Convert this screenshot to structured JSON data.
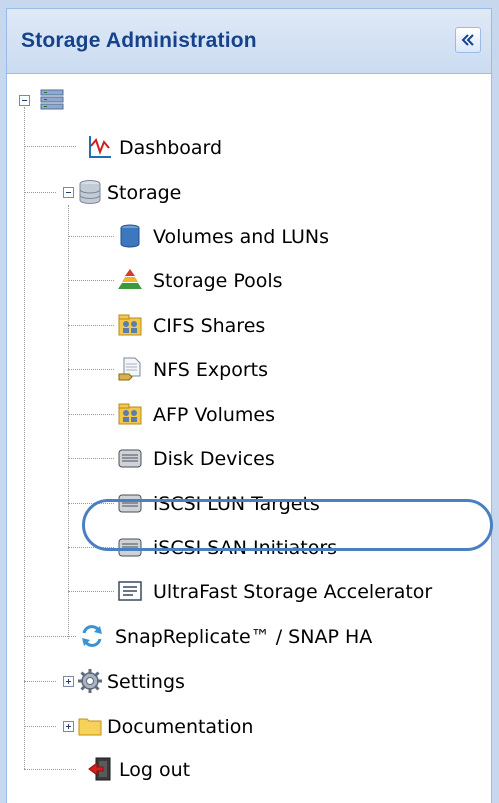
{
  "panel": {
    "title": "Storage Administration",
    "collapse_icon": "double-chevron-left-icon"
  },
  "tree": {
    "root_icon": "server-icon",
    "dashboard": {
      "label": "Dashboard",
      "icon": "line-chart-icon"
    },
    "storage": {
      "label": "Storage",
      "icon": "database-icon",
      "expanded": true,
      "children": [
        {
          "label": "Volumes and LUNs",
          "icon": "cylinder-icon"
        },
        {
          "label": "Storage Pools",
          "icon": "pyramid-icon"
        },
        {
          "label": "CIFS Shares",
          "icon": "users-folder-icon"
        },
        {
          "label": "NFS Exports",
          "icon": "document-export-icon"
        },
        {
          "label": "AFP Volumes",
          "icon": "users-folder-icon"
        },
        {
          "label": "Disk Devices",
          "icon": "disk-icon"
        },
        {
          "label": "iSCSI LUN Targets",
          "icon": "disk-icon"
        },
        {
          "label": "iSCSI SAN Initiators",
          "icon": "disk-icon"
        },
        {
          "label": "UltraFast Storage Accelerator",
          "icon": "accelerator-list-icon",
          "highlighted": true
        }
      ]
    },
    "snapreplicate": {
      "label": "SnapReplicate™ / SNAP HA",
      "icon": "refresh-arrows-icon"
    },
    "settings": {
      "label": "Settings",
      "icon": "gear-icon",
      "expanded": false
    },
    "documentation": {
      "label": "Documentation",
      "icon": "folder-icon",
      "expanded": false
    },
    "logout": {
      "label": "Log out",
      "icon": "logout-door-icon"
    }
  },
  "colors": {
    "header_text": "#15428b",
    "highlight_ring": "#4a7fc1",
    "panel_border": "#99bbe8"
  }
}
